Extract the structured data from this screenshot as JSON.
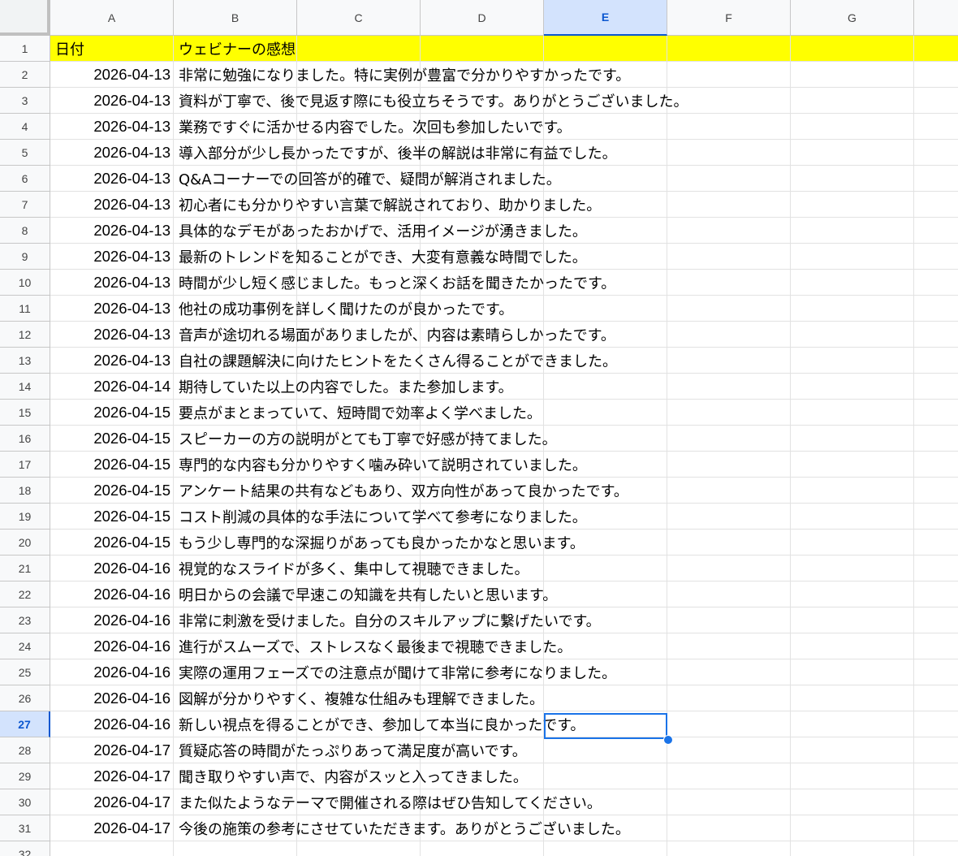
{
  "columns": [
    "A",
    "B",
    "C",
    "D",
    "E",
    "F",
    "G"
  ],
  "active_column": "E",
  "active_row": 27,
  "selected_cell": "E27",
  "header_fill_color": "#ffff00",
  "selection_color": "#1a73e8",
  "headers": {
    "date": "日付",
    "feedback": "ウェビナーの感想"
  },
  "rows": [
    {
      "date": "2026-04-13",
      "comment": "非常に勉強になりました。特に実例が豊富で分かりやすかったです。"
    },
    {
      "date": "2026-04-13",
      "comment": "資料が丁寧で、後で見返す際にも役立ちそうです。ありがとうございました。"
    },
    {
      "date": "2026-04-13",
      "comment": "業務ですぐに活かせる内容でした。次回も参加したいです。"
    },
    {
      "date": "2026-04-13",
      "comment": "導入部分が少し長かったですが、後半の解説は非常に有益でした。"
    },
    {
      "date": "2026-04-13",
      "comment": "Q&Aコーナーでの回答が的確で、疑問が解消されました。"
    },
    {
      "date": "2026-04-13",
      "comment": "初心者にも分かりやすい言葉で解説されており、助かりました。"
    },
    {
      "date": "2026-04-13",
      "comment": "具体的なデモがあったおかげで、活用イメージが湧きました。"
    },
    {
      "date": "2026-04-13",
      "comment": "最新のトレンドを知ることができ、大変有意義な時間でした。"
    },
    {
      "date": "2026-04-13",
      "comment": "時間が少し短く感じました。もっと深くお話を聞きたかったです。"
    },
    {
      "date": "2026-04-13",
      "comment": "他社の成功事例を詳しく聞けたのが良かったです。"
    },
    {
      "date": "2026-04-13",
      "comment": "音声が途切れる場面がありましたが、内容は素晴らしかったです。"
    },
    {
      "date": "2026-04-13",
      "comment": "自社の課題解決に向けたヒントをたくさん得ることができました。"
    },
    {
      "date": "2026-04-14",
      "comment": "期待していた以上の内容でした。また参加します。"
    },
    {
      "date": "2026-04-15",
      "comment": "要点がまとまっていて、短時間で効率よく学べました。"
    },
    {
      "date": "2026-04-15",
      "comment": "スピーカーの方の説明がとても丁寧で好感が持てました。"
    },
    {
      "date": "2026-04-15",
      "comment": "専門的な内容も分かりやすく噛み砕いて説明されていました。"
    },
    {
      "date": "2026-04-15",
      "comment": "アンケート結果の共有などもあり、双方向性があって良かったです。"
    },
    {
      "date": "2026-04-15",
      "comment": "コスト削減の具体的な手法について学べて参考になりました。"
    },
    {
      "date": "2026-04-15",
      "comment": "もう少し専門的な深掘りがあっても良かったかなと思います。"
    },
    {
      "date": "2026-04-16",
      "comment": "視覚的なスライドが多く、集中して視聴できました。"
    },
    {
      "date": "2026-04-16",
      "comment": "明日からの会議で早速この知識を共有したいと思います。"
    },
    {
      "date": "2026-04-16",
      "comment": "非常に刺激を受けました。自分のスキルアップに繋げたいです。"
    },
    {
      "date": "2026-04-16",
      "comment": "進行がスムーズで、ストレスなく最後まで視聴できました。"
    },
    {
      "date": "2026-04-16",
      "comment": "実際の運用フェーズでの注意点が聞けて非常に参考になりました。"
    },
    {
      "date": "2026-04-16",
      "comment": "図解が分かりやすく、複雑な仕組みも理解できました。"
    },
    {
      "date": "2026-04-16",
      "comment": "新しい視点を得ることができ、参加して本当に良かったです。"
    },
    {
      "date": "2026-04-17",
      "comment": "質疑応答の時間がたっぷりあって満足度が高いです。"
    },
    {
      "date": "2026-04-17",
      "comment": "聞き取りやすい声で、内容がスッと入ってきました。"
    },
    {
      "date": "2026-04-17",
      "comment": "また似たようなテーマで開催される際はぜひ告知してください。"
    },
    {
      "date": "2026-04-17",
      "comment": "今後の施策の参考にさせていただきます。ありがとうございました。"
    },
    {
      "date": "",
      "comment": ""
    }
  ]
}
